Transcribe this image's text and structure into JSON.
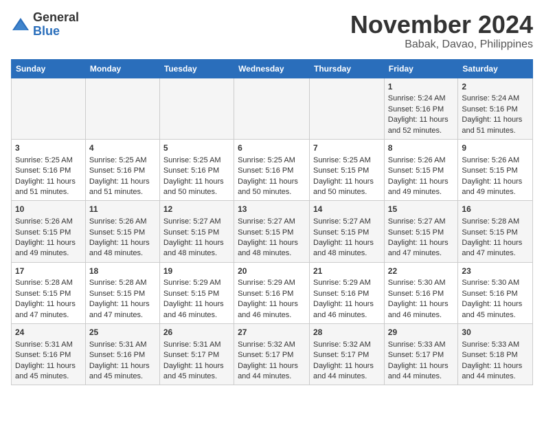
{
  "logo": {
    "general": "General",
    "blue": "Blue"
  },
  "title": {
    "month": "November 2024",
    "location": "Babak, Davao, Philippines"
  },
  "headers": [
    "Sunday",
    "Monday",
    "Tuesday",
    "Wednesday",
    "Thursday",
    "Friday",
    "Saturday"
  ],
  "weeks": [
    [
      {
        "day": "",
        "sunrise": "",
        "sunset": "",
        "daylight": ""
      },
      {
        "day": "",
        "sunrise": "",
        "sunset": "",
        "daylight": ""
      },
      {
        "day": "",
        "sunrise": "",
        "sunset": "",
        "daylight": ""
      },
      {
        "day": "",
        "sunrise": "",
        "sunset": "",
        "daylight": ""
      },
      {
        "day": "",
        "sunrise": "",
        "sunset": "",
        "daylight": ""
      },
      {
        "day": "1",
        "sunrise": "Sunrise: 5:24 AM",
        "sunset": "Sunset: 5:16 PM",
        "daylight": "Daylight: 11 hours and 52 minutes."
      },
      {
        "day": "2",
        "sunrise": "Sunrise: 5:24 AM",
        "sunset": "Sunset: 5:16 PM",
        "daylight": "Daylight: 11 hours and 51 minutes."
      }
    ],
    [
      {
        "day": "3",
        "sunrise": "Sunrise: 5:25 AM",
        "sunset": "Sunset: 5:16 PM",
        "daylight": "Daylight: 11 hours and 51 minutes."
      },
      {
        "day": "4",
        "sunrise": "Sunrise: 5:25 AM",
        "sunset": "Sunset: 5:16 PM",
        "daylight": "Daylight: 11 hours and 51 minutes."
      },
      {
        "day": "5",
        "sunrise": "Sunrise: 5:25 AM",
        "sunset": "Sunset: 5:16 PM",
        "daylight": "Daylight: 11 hours and 50 minutes."
      },
      {
        "day": "6",
        "sunrise": "Sunrise: 5:25 AM",
        "sunset": "Sunset: 5:16 PM",
        "daylight": "Daylight: 11 hours and 50 minutes."
      },
      {
        "day": "7",
        "sunrise": "Sunrise: 5:25 AM",
        "sunset": "Sunset: 5:15 PM",
        "daylight": "Daylight: 11 hours and 50 minutes."
      },
      {
        "day": "8",
        "sunrise": "Sunrise: 5:26 AM",
        "sunset": "Sunset: 5:15 PM",
        "daylight": "Daylight: 11 hours and 49 minutes."
      },
      {
        "day": "9",
        "sunrise": "Sunrise: 5:26 AM",
        "sunset": "Sunset: 5:15 PM",
        "daylight": "Daylight: 11 hours and 49 minutes."
      }
    ],
    [
      {
        "day": "10",
        "sunrise": "Sunrise: 5:26 AM",
        "sunset": "Sunset: 5:15 PM",
        "daylight": "Daylight: 11 hours and 49 minutes."
      },
      {
        "day": "11",
        "sunrise": "Sunrise: 5:26 AM",
        "sunset": "Sunset: 5:15 PM",
        "daylight": "Daylight: 11 hours and 48 minutes."
      },
      {
        "day": "12",
        "sunrise": "Sunrise: 5:27 AM",
        "sunset": "Sunset: 5:15 PM",
        "daylight": "Daylight: 11 hours and 48 minutes."
      },
      {
        "day": "13",
        "sunrise": "Sunrise: 5:27 AM",
        "sunset": "Sunset: 5:15 PM",
        "daylight": "Daylight: 11 hours and 48 minutes."
      },
      {
        "day": "14",
        "sunrise": "Sunrise: 5:27 AM",
        "sunset": "Sunset: 5:15 PM",
        "daylight": "Daylight: 11 hours and 48 minutes."
      },
      {
        "day": "15",
        "sunrise": "Sunrise: 5:27 AM",
        "sunset": "Sunset: 5:15 PM",
        "daylight": "Daylight: 11 hours and 47 minutes."
      },
      {
        "day": "16",
        "sunrise": "Sunrise: 5:28 AM",
        "sunset": "Sunset: 5:15 PM",
        "daylight": "Daylight: 11 hours and 47 minutes."
      }
    ],
    [
      {
        "day": "17",
        "sunrise": "Sunrise: 5:28 AM",
        "sunset": "Sunset: 5:15 PM",
        "daylight": "Daylight: 11 hours and 47 minutes."
      },
      {
        "day": "18",
        "sunrise": "Sunrise: 5:28 AM",
        "sunset": "Sunset: 5:15 PM",
        "daylight": "Daylight: 11 hours and 47 minutes."
      },
      {
        "day": "19",
        "sunrise": "Sunrise: 5:29 AM",
        "sunset": "Sunset: 5:15 PM",
        "daylight": "Daylight: 11 hours and 46 minutes."
      },
      {
        "day": "20",
        "sunrise": "Sunrise: 5:29 AM",
        "sunset": "Sunset: 5:16 PM",
        "daylight": "Daylight: 11 hours and 46 minutes."
      },
      {
        "day": "21",
        "sunrise": "Sunrise: 5:29 AM",
        "sunset": "Sunset: 5:16 PM",
        "daylight": "Daylight: 11 hours and 46 minutes."
      },
      {
        "day": "22",
        "sunrise": "Sunrise: 5:30 AM",
        "sunset": "Sunset: 5:16 PM",
        "daylight": "Daylight: 11 hours and 46 minutes."
      },
      {
        "day": "23",
        "sunrise": "Sunrise: 5:30 AM",
        "sunset": "Sunset: 5:16 PM",
        "daylight": "Daylight: 11 hours and 45 minutes."
      }
    ],
    [
      {
        "day": "24",
        "sunrise": "Sunrise: 5:31 AM",
        "sunset": "Sunset: 5:16 PM",
        "daylight": "Daylight: 11 hours and 45 minutes."
      },
      {
        "day": "25",
        "sunrise": "Sunrise: 5:31 AM",
        "sunset": "Sunset: 5:16 PM",
        "daylight": "Daylight: 11 hours and 45 minutes."
      },
      {
        "day": "26",
        "sunrise": "Sunrise: 5:31 AM",
        "sunset": "Sunset: 5:17 PM",
        "daylight": "Daylight: 11 hours and 45 minutes."
      },
      {
        "day": "27",
        "sunrise": "Sunrise: 5:32 AM",
        "sunset": "Sunset: 5:17 PM",
        "daylight": "Daylight: 11 hours and 44 minutes."
      },
      {
        "day": "28",
        "sunrise": "Sunrise: 5:32 AM",
        "sunset": "Sunset: 5:17 PM",
        "daylight": "Daylight: 11 hours and 44 minutes."
      },
      {
        "day": "29",
        "sunrise": "Sunrise: 5:33 AM",
        "sunset": "Sunset: 5:17 PM",
        "daylight": "Daylight: 11 hours and 44 minutes."
      },
      {
        "day": "30",
        "sunrise": "Sunrise: 5:33 AM",
        "sunset": "Sunset: 5:18 PM",
        "daylight": "Daylight: 11 hours and 44 minutes."
      }
    ]
  ]
}
